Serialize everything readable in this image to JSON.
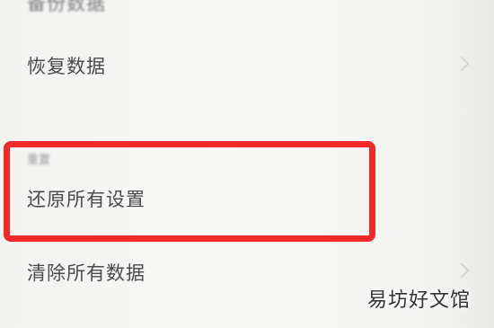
{
  "settings": {
    "items": [
      {
        "label": "备份数据",
        "has_chevron": false
      },
      {
        "label": "恢复数据",
        "has_chevron": true
      },
      {
        "label": "还原所有设置",
        "has_chevron": false
      },
      {
        "label": "清除所有数据",
        "has_chevron": true
      }
    ],
    "section_label": "重置"
  },
  "annotation": {
    "highlight_color": "#f02a2a"
  },
  "watermark": {
    "text": "易坊好文馆"
  }
}
